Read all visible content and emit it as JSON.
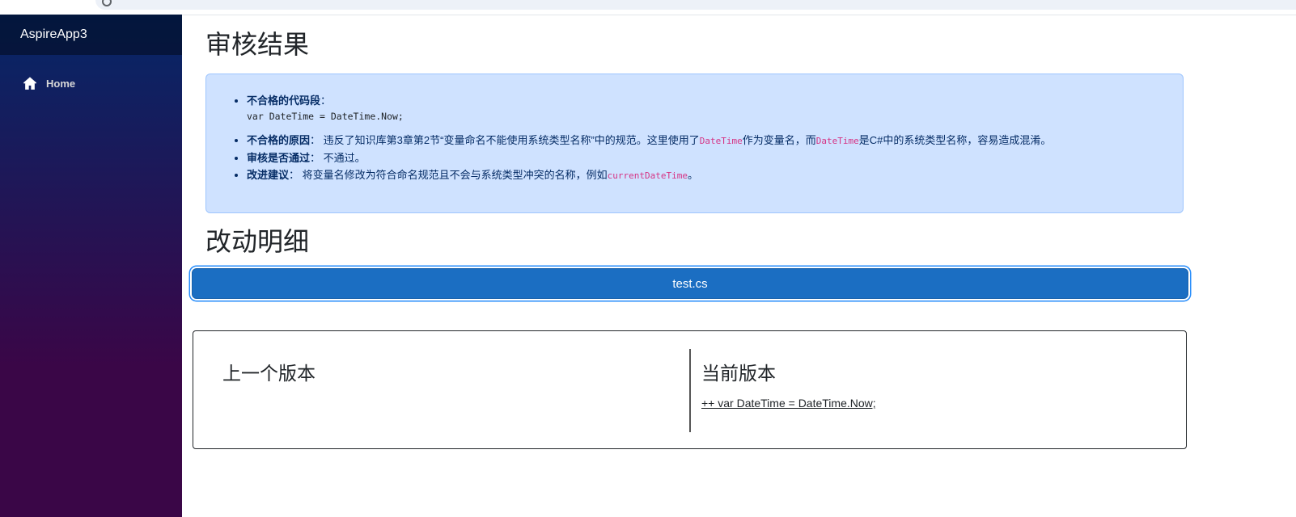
{
  "sidebar": {
    "brand": "AspireApp3",
    "items": [
      {
        "label": "Home",
        "icon": "home-icon"
      }
    ]
  },
  "main": {
    "review_heading": "审核结果",
    "review": {
      "bad_code_label": "不合格的代码段",
      "bad_code": "var DateTime = DateTime.Now;",
      "reason_label": "不合格的原因",
      "reason_text_1": "违反了知识库第3章第2节“变量命名不能使用系统类型名称”中的规范。这里使用了",
      "reason_code_1": "DateTime",
      "reason_text_2": "作为变量名，而",
      "reason_code_2": "DateTime",
      "reason_text_3": "是C#中的系统类型名称，容易造成混淆。",
      "pass_label": "审核是否通过",
      "pass_value": "不通过。",
      "suggest_label": "改进建议",
      "suggest_text": "将变量名修改为符合命名规范且不会与系统类型冲突的名称，例如",
      "suggest_code": "currentDateTime",
      "suggest_end": "。",
      "colon": "："
    },
    "changes_heading": "改动明细",
    "file_button": "test.cs",
    "diff": {
      "previous_title": "上一个版本",
      "current_title": "当前版本",
      "current_line": "++ var DateTime = DateTime.Now;"
    }
  },
  "colors": {
    "primary_button": "#1b6ec2",
    "alert_bg": "#cfe2ff",
    "sidebar_top": "#052767",
    "sidebar_bottom": "#3a0647",
    "inline_code": "#d63384"
  }
}
